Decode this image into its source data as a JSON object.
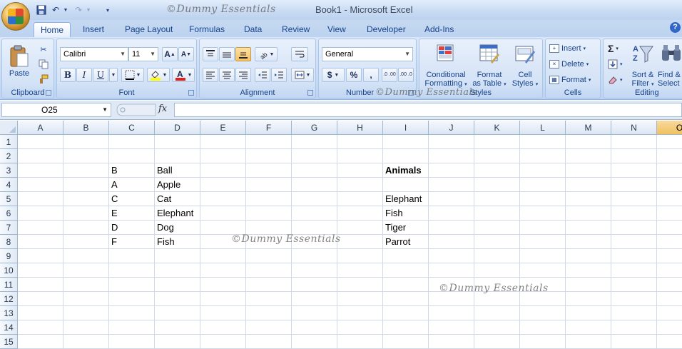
{
  "window": {
    "title": "Book1 - Microsoft Excel",
    "watermark": "©Dummy Essentials"
  },
  "tabs": [
    {
      "label": "Home",
      "active": true
    },
    {
      "label": "Insert"
    },
    {
      "label": "Page Layout"
    },
    {
      "label": "Formulas"
    },
    {
      "label": "Data"
    },
    {
      "label": "Review"
    },
    {
      "label": "View"
    },
    {
      "label": "Developer"
    },
    {
      "label": "Add-Ins"
    }
  ],
  "ribbon": {
    "clipboard": {
      "label": "Clipboard",
      "paste": "Paste"
    },
    "font": {
      "label": "Font",
      "name": "Calibri",
      "size": "11",
      "bold": "B",
      "italic": "I",
      "underline": "U"
    },
    "alignment": {
      "label": "Alignment"
    },
    "number": {
      "label": "Number",
      "format": "General",
      "currency": "$",
      "percent": "%",
      "comma": ",",
      "inc_decimal": ".0 .00",
      "dec_decimal": ".00 .0"
    },
    "styles": {
      "label": "Styles",
      "conditional_1": "Conditional",
      "conditional_2": "Formatting",
      "format_table_1": "Format",
      "format_table_2": "as Table",
      "cell_styles_1": "Cell",
      "cell_styles_2": "Styles"
    },
    "cells": {
      "label": "Cells",
      "insert": "Insert",
      "delete": "Delete",
      "format": "Format"
    },
    "editing": {
      "label": "Editing",
      "sort_1": "Sort &",
      "sort_2": "Filter",
      "find_1": "Find &",
      "find_2": "Select"
    }
  },
  "formula_bar": {
    "name_box": "O25",
    "fx": "fx",
    "content": ""
  },
  "sheet": {
    "columns": [
      "A",
      "B",
      "C",
      "D",
      "E",
      "F",
      "G",
      "H",
      "I",
      "J",
      "K",
      "L",
      "M",
      "N",
      "O"
    ],
    "rows": [
      "1",
      "2",
      "3",
      "4",
      "5",
      "6",
      "7",
      "8",
      "9",
      "10",
      "11",
      "12",
      "13",
      "14",
      "15"
    ],
    "selected_column": "O",
    "cells": {
      "C3": "B",
      "D3": "Ball",
      "I3": "Animals",
      "C4": "A",
      "D4": "Apple",
      "C5": "C",
      "D5": "Cat",
      "I5": "Elephant",
      "C6": "E",
      "D6": "Elephant",
      "I6": "Fish",
      "C7": "D",
      "D7": "Dog",
      "I7": "Tiger",
      "C8": "F",
      "D8": "Fish",
      "I8": "Parrot"
    }
  },
  "colors": {
    "selected_header": "#f1c15f",
    "ribbon_text": "#15428b"
  }
}
